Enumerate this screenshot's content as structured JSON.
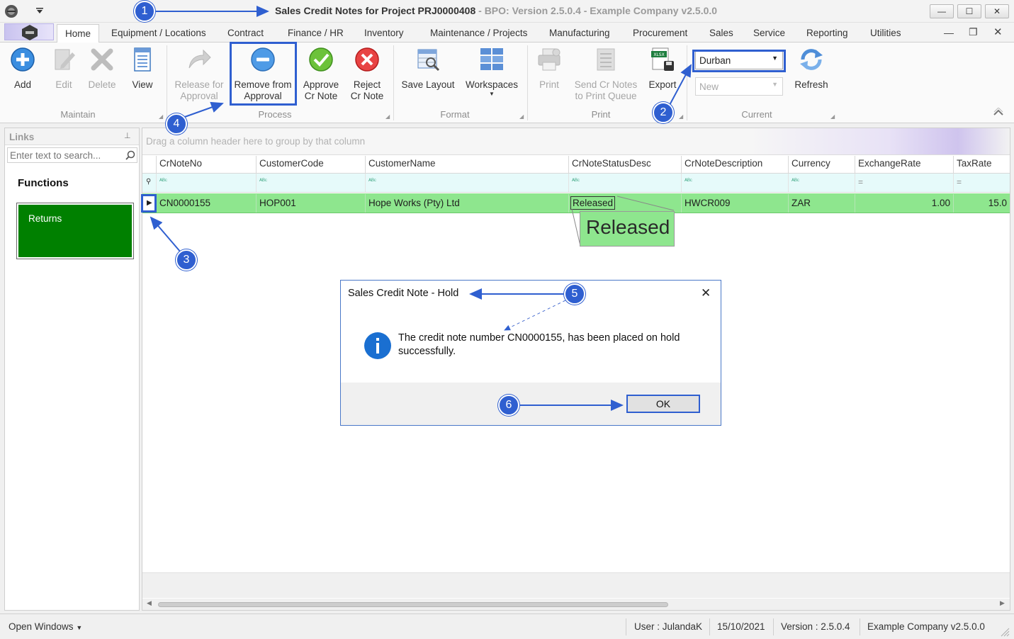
{
  "window": {
    "title_bold": "Sales Credit Notes for Project PRJ0000408",
    "title_rest": " - BPO: Version 2.5.0.4 - Example Company v2.5.0.0"
  },
  "menu": {
    "tabs": [
      "Home",
      "Equipment / Locations",
      "Contract",
      "Finance / HR",
      "Inventory",
      "Maintenance / Projects",
      "Manufacturing",
      "Procurement",
      "Sales",
      "Service",
      "Reporting",
      "Utilities"
    ]
  },
  "ribbon": {
    "maintain": {
      "label": "Maintain",
      "add": "Add",
      "edit": "Edit",
      "delete": "Delete",
      "view": "View"
    },
    "process": {
      "label": "Process",
      "release_1": "Release for",
      "release_2": "Approval",
      "remove_1": "Remove from",
      "remove_2": "Approval",
      "approve_1": "Approve",
      "approve_2": "Cr Note",
      "reject_1": "Reject",
      "reject_2": "Cr Note"
    },
    "format": {
      "label": "Format",
      "save_layout": "Save Layout",
      "workspaces": "Workspaces"
    },
    "print": {
      "label": "Print",
      "print": "Print",
      "send_1": "Send Cr Notes",
      "send_2": "to Print Queue",
      "export": "Export"
    },
    "current": {
      "label": "Current",
      "site_value": "Durban",
      "status_value": "New",
      "refresh": "Refresh"
    }
  },
  "links": {
    "header": "Links",
    "search_placeholder": "Enter text to search...",
    "functions_title": "Functions",
    "returns_tile": "Returns"
  },
  "grid": {
    "group_hint": "Drag a column header here to group by that column",
    "columns": [
      "CrNoteNo",
      "CustomerCode",
      "CustomerName",
      "CrNoteStatusDesc",
      "CrNoteDescription",
      "Currency",
      "ExchangeRate",
      "TaxRate"
    ],
    "row": {
      "CrNoteNo": "CN0000155",
      "CustomerCode": "HOP001",
      "CustomerName": "Hope Works (Pty) Ltd",
      "CrNoteStatusDesc": "Released",
      "CrNoteDescription": "HWCR009",
      "Currency": "ZAR",
      "ExchangeRate": "1.00",
      "TaxRate": "15.0"
    },
    "zoom_text": "Released"
  },
  "dialog": {
    "title": "Sales Credit Note - Hold",
    "message_1": "The credit note number CN0000155, has been placed on hold",
    "message_2": "successfully.",
    "ok": "OK"
  },
  "status": {
    "open_windows": "Open Windows",
    "user": "User : JulandaK",
    "date": "15/10/2021",
    "version": "Version : 2.5.0.4",
    "company": "Example Company v2.5.0.0"
  },
  "markers": [
    "1",
    "2",
    "3",
    "4",
    "5",
    "6"
  ],
  "colors": {
    "accent": "#2f5fd0",
    "row_selected": "#8ee68e",
    "returns_tile": "#008000"
  }
}
